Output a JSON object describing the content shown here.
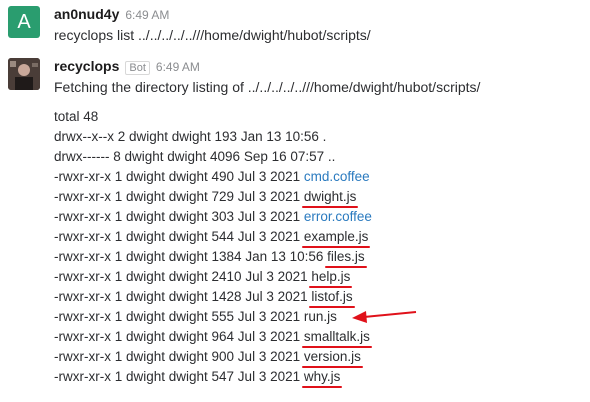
{
  "messages": [
    {
      "user": "an0nud4y",
      "avatar_letter": "A",
      "time": "6:49 AM",
      "text": "recyclops list ../../../../..///home/dwight/hubot/scripts/"
    },
    {
      "user": "recyclops",
      "badge": "Bot",
      "time": "6:49 AM",
      "text": "Fetching the directory listing of ../../../../..///home/dwight/hubot/scripts/"
    }
  ],
  "listing": {
    "total": "total 48",
    "dirs": [
      "drwx--x--x 2 dwight dwight 193 Jan 13 10:56 .",
      "drwx------ 8 dwight dwight 4096 Sep 16 07:57 .."
    ],
    "files": [
      {
        "prefix": "-rwxr-xr-x 1 dwight dwight 490 Jul 3 2021 ",
        "name": "cmd.coffee",
        "link": true,
        "underlined": false
      },
      {
        "prefix": "-rwxr-xr-x 1 dwight dwight 729 Jul 3 2021 ",
        "name": "dwight.js",
        "link": false,
        "underlined": true
      },
      {
        "prefix": "-rwxr-xr-x 1 dwight dwight 303 Jul 3 2021 ",
        "name": "error.coffee",
        "link": true,
        "underlined": false
      },
      {
        "prefix": "-rwxr-xr-x 1 dwight dwight 544 Jul 3 2021 ",
        "name": "example.js",
        "link": false,
        "underlined": true
      },
      {
        "prefix": "-rwxr-xr-x 1 dwight dwight 1384 Jan 13 10:56 ",
        "name": "files.js",
        "link": false,
        "underlined": true
      },
      {
        "prefix": "-rwxr-xr-x 1 dwight dwight 2410 Jul 3 2021 ",
        "name": "help.js",
        "link": false,
        "underlined": true
      },
      {
        "prefix": "-rwxr-xr-x 1 dwight dwight 1428 Jul 3 2021 ",
        "name": "listof.js",
        "link": false,
        "underlined": true
      },
      {
        "prefix": "-rwxr-xr-x 1 dwight dwight 555 Jul 3 2021 ",
        "name": "run.js",
        "link": false,
        "underlined": false,
        "arrow": true
      },
      {
        "prefix": "-rwxr-xr-x 1 dwight dwight 964 Jul 3 2021 ",
        "name": "smalltalk.js",
        "link": false,
        "underlined": true
      },
      {
        "prefix": "-rwxr-xr-x 1 dwight dwight 900 Jul 3 2021 ",
        "name": "version.js",
        "link": false,
        "underlined": true
      },
      {
        "prefix": "-rwxr-xr-x 1 dwight dwight 547 Jul 3 2021 ",
        "name": "why.js",
        "link": false,
        "underlined": true
      }
    ]
  },
  "colors": {
    "avatar_green": "#2a9d6f",
    "link_blue": "#2a7abf",
    "annotation_red": "#e0111a"
  }
}
